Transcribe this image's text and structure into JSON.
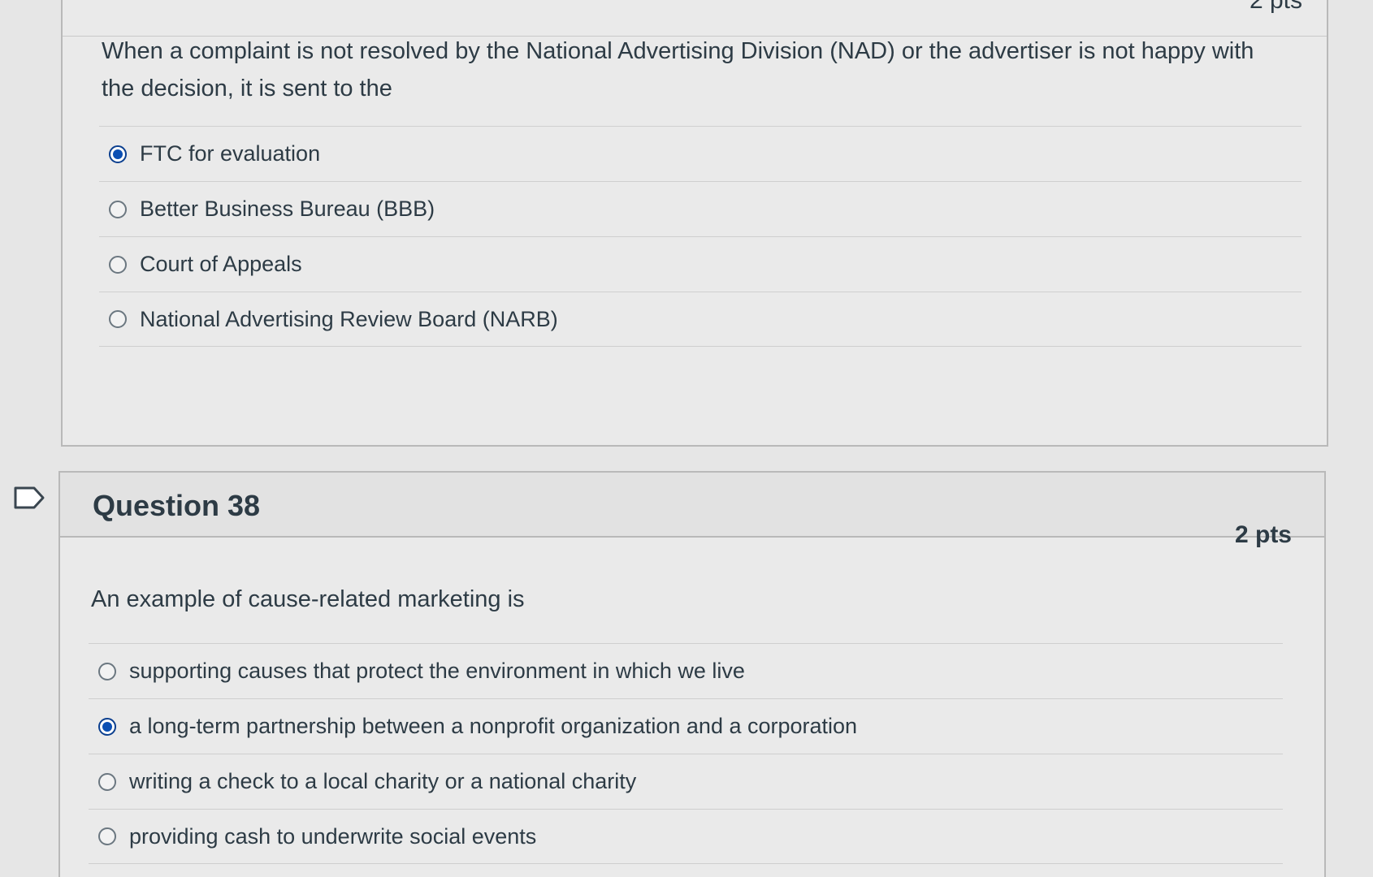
{
  "question37": {
    "points": "2 pts",
    "text": "When a complaint is not resolved by the National Advertising Division (NAD) or the advertiser is not happy with the decision, it is sent to the",
    "answers": [
      {
        "label": "FTC for evaluation",
        "selected": true
      },
      {
        "label": "Better Business Bureau (BBB)",
        "selected": false
      },
      {
        "label": "Court of Appeals",
        "selected": false
      },
      {
        "label": "National Advertising Review Board (NARB)",
        "selected": false
      }
    ]
  },
  "question38": {
    "title": "Question 38",
    "points": "2 pts",
    "text": "An example of cause-related marketing is",
    "answers": [
      {
        "label": "supporting causes that protect the environment in which we live",
        "selected": false
      },
      {
        "label": "a long-term partnership between a nonprofit organization and a corporation",
        "selected": true
      },
      {
        "label": "writing a check to a local charity or a national charity",
        "selected": false
      },
      {
        "label": "providing cash to underwrite social events",
        "selected": false
      }
    ]
  },
  "colors": {
    "radio_selected": "#0b4fb3",
    "text": "#2d3b45",
    "border": "#b9b9b9"
  }
}
